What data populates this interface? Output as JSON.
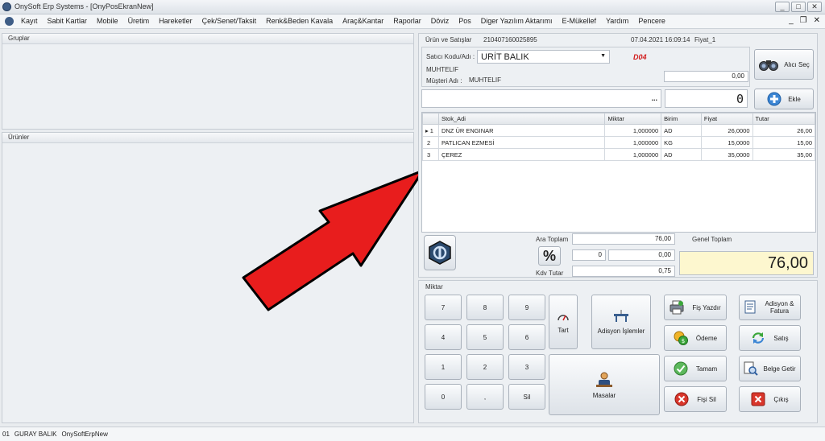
{
  "window": {
    "title": "OnySoft Erp Systems - [OnyPosEkranNew]",
    "controls": [
      "_",
      "□",
      "✕"
    ],
    "mdi_controls": [
      "_",
      "❐",
      "✕"
    ]
  },
  "menu": [
    "Kayıt",
    "Sabit Kartlar",
    "Mobile",
    "Üretim",
    "Hareketler",
    "Çek/Senet/Taksit",
    "Renk&Beden Kavala",
    "Araç&Kantar",
    "Raporlar",
    "Döviz",
    "Pos",
    "Diger Yazılım Aktarımı",
    "E-Mükellef",
    "Yardım",
    "Pencere"
  ],
  "left": {
    "groups_title": "Gruplar",
    "products_title": "Ürünler"
  },
  "sale": {
    "panel_title": "Ürün ve Satışlar",
    "doc_no": "210407160025895",
    "datetime": "07.04.2021 16:09:14",
    "price_type": "Fiyat_1",
    "seller_label": "Satıcı Kodu/Adı :",
    "seller_value": "URİT BALIK",
    "seller_sub": "MUHTELIF",
    "code_badge": "D04",
    "customer_label": "Müşteri Adı :",
    "customer_value": "MUHTELIF",
    "balance_value": "0,00",
    "select_customer_btn": "Alıcı Seç",
    "barcode_dots": "...",
    "qty_value": "0",
    "add_btn": "Ekle"
  },
  "table": {
    "headers": [
      "",
      "Stok_Adi",
      "Miktar",
      "Birim",
      "Fiyat",
      "Tutar"
    ],
    "rows": [
      {
        "no": "1",
        "marker": "▸",
        "name": "DNZ ÜR ENGINAR",
        "qty": "1,000000",
        "unit": "AD",
        "price": "26,0000",
        "total": "26,00"
      },
      {
        "no": "2",
        "marker": "",
        "name": "PATLICAN EZMESİ",
        "qty": "1,000000",
        "unit": "KG",
        "price": "15,0000",
        "total": "15,00"
      },
      {
        "no": "3",
        "marker": "",
        "name": "ÇEREZ",
        "qty": "1,000000",
        "unit": "AD",
        "price": "35,0000",
        "total": "35,00"
      }
    ]
  },
  "totals": {
    "subtotal_label": "Ara Toplam",
    "subtotal_value": "76,00",
    "discount_pct": "0",
    "discount_value": "0,00",
    "vat_label": "Kdv Tutar",
    "vat_value": "0,75",
    "grand_label": "Genel Toplam",
    "grand_value": "76,00",
    "percent_symbol": "%"
  },
  "keypad": {
    "title": "Miktar",
    "keys": [
      "7",
      "8",
      "9",
      "4",
      "5",
      "6",
      "1",
      "2",
      "3",
      "0",
      ",",
      "Sil"
    ]
  },
  "actions": {
    "tart": "Tart",
    "adisyon_islemler": "Adisyon İşlemler",
    "masalar": "Masalar",
    "fis_yazdir": "Fiş Yazdır",
    "odeme": "Ödeme",
    "tamam": "Tamam",
    "fisi_sil": "Fişi Sil",
    "adisyon_fatura": "Adisyon & Fatura",
    "satis": "Satış",
    "belge_getir": "Belge Getir",
    "cikis": "Çıkış"
  },
  "status": {
    "code": "01",
    "user": "GURAY BALIK",
    "app": "OnySoftErpNew"
  },
  "colors": {
    "arrow": "#e81d1d",
    "grand_total_bg": "#fdf7cf",
    "badge": "#d21c1c"
  }
}
